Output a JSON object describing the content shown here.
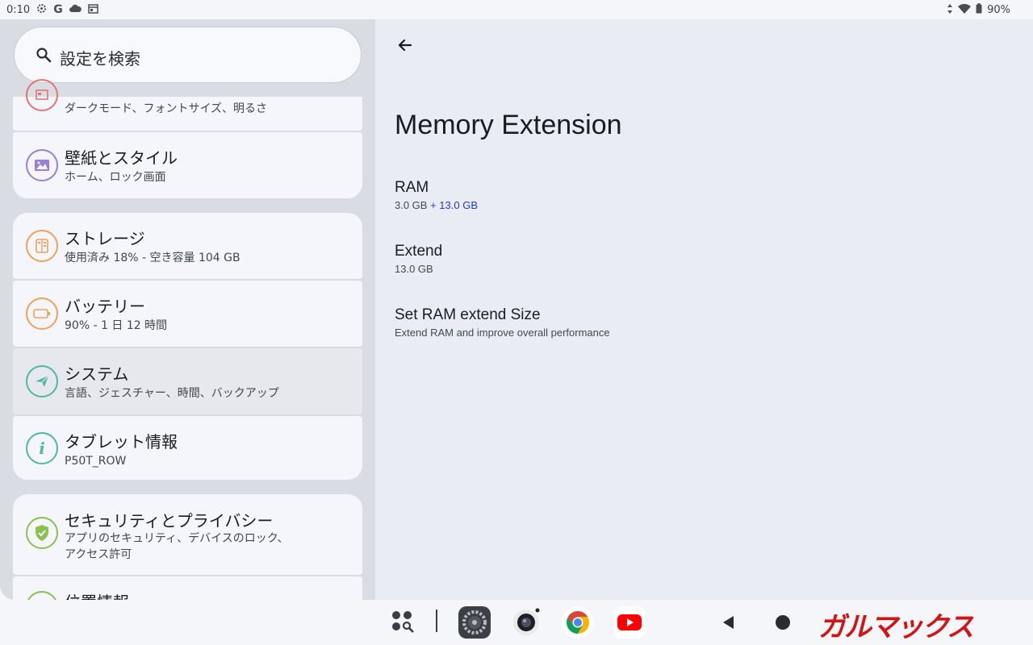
{
  "status_bar": {
    "time": "0:10",
    "battery": "90%",
    "left_icons": [
      "gear-icon",
      "google-icon",
      "cloud-icon",
      "calendar-icon"
    ],
    "right_icons": [
      "data-arrows-icon",
      "wifi-icon",
      "battery-icon"
    ]
  },
  "search": {
    "placeholder": "設定を検索"
  },
  "settings_list": {
    "display": {
      "subtitle": "ダークモード、フォントサイズ、明るさ",
      "icon": "display-icon",
      "color": "#e57373"
    },
    "wallpaper": {
      "title": "壁紙とスタイル",
      "subtitle": "ホーム、ロック画面",
      "icon": "image-icon",
      "color": "#9b7fd6"
    },
    "storage": {
      "title": "ストレージ",
      "subtitle": "使用済み 18% - 空き容量 104 GB",
      "icon": "storage-icon",
      "color": "#f0a15a"
    },
    "battery": {
      "title": "バッテリー",
      "subtitle": "90% - 1 日 12 時間",
      "icon": "battery-icon",
      "color": "#f0a15a"
    },
    "system": {
      "title": "システム",
      "subtitle": "言語、ジェスチャー、時間、バックアップ",
      "icon": "paper-plane-icon",
      "color": "#4fb9a0"
    },
    "tablet_info": {
      "title": "タブレット情報",
      "subtitle": "P50T_ROW",
      "icon": "info-icon",
      "color": "#4fb9a0"
    },
    "security": {
      "title": "セキュリティとプライバシー",
      "subtitle_line1": "アプリのセキュリティ、デバイスのロック、",
      "subtitle_line2": "アクセス許可",
      "icon": "shield-check-icon",
      "color": "#8cc152"
    },
    "location": {
      "title": "位置情報",
      "icon": "location-icon",
      "color": "#8cc152"
    }
  },
  "detail": {
    "title": "Memory Extension",
    "items": [
      {
        "label": "RAM",
        "value": "3.0 GB",
        "value_extra": "+ 13.0 GB"
      },
      {
        "label": "Extend",
        "value": "13.0 GB"
      },
      {
        "label": "Set RAM extend Size",
        "value": "Extend RAM and improve overall performance"
      }
    ]
  },
  "taskbar": {
    "apps": [
      "app-drawer-icon",
      "settings-app-icon",
      "camera-app-icon",
      "chrome-app-icon",
      "youtube-app-icon"
    ],
    "nav": [
      "back-icon",
      "home-icon"
    ],
    "watermark": "ガルマックス"
  }
}
